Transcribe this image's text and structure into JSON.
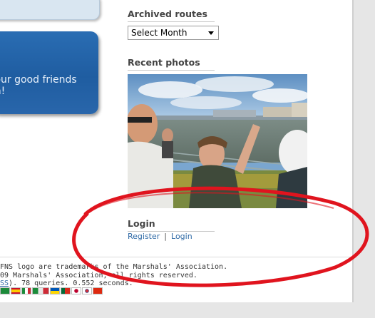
{
  "left_column": {
    "promo_text": " our good friends\nm!"
  },
  "sidebar": {
    "archived": {
      "title": "Archived routes",
      "select_value": "Select Month"
    },
    "photos": {
      "title": "Recent photos"
    },
    "login": {
      "title": "Login",
      "register_label": "Register",
      "separator": "|",
      "login_label": "Login"
    }
  },
  "footer": {
    "line1": "FNS logo are trademarks of the Marshals' Association.",
    "line2": "09 Marshals' Association, all rights reserved.",
    "line3_link": "SS",
    "line3_rest": "). 78 queries. 0.552 seconds.",
    "flags": [
      "saudi-arabia-flag",
      "spain-flag",
      "italy-flag",
      "ukraine-flag",
      "portugal-flag",
      "japan-flag",
      "south-korea-flag",
      "china-flag"
    ]
  },
  "colors": {
    "promo_blue": "#1f5da1",
    "link_blue": "#2f6aa6",
    "annotation_red": "#e0141e"
  }
}
